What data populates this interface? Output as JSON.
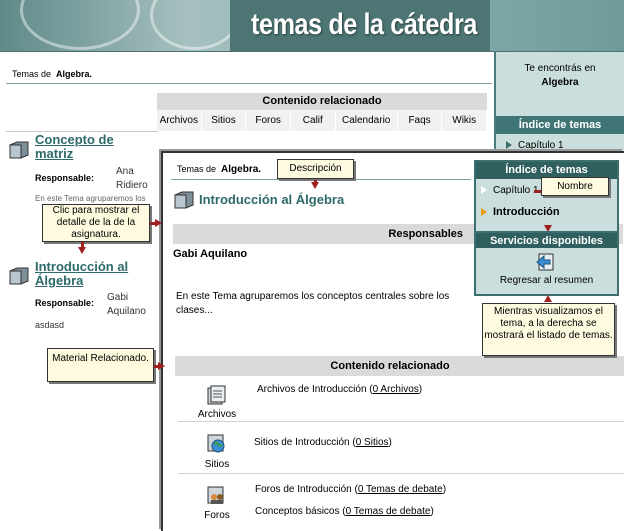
{
  "banner": {
    "title": "temas de la cátedra"
  },
  "background_page": {
    "breadcrumb_prefix": "Temas de",
    "breadcrumb_subject": "Algebra.",
    "related_content": {
      "header": "Contenido relacionado",
      "columns": [
        "Archivos",
        "Sitios",
        "Foros",
        "Calif",
        "Calendario",
        "Faqs",
        "Wikis"
      ]
    },
    "topics": [
      {
        "title_line1": "Concepto de",
        "title_line2": "matriz",
        "responsible_label": "Responsable:",
        "responsible_name_1": "Ana",
        "responsible_name_2": "Ridiero",
        "description": "En este Tema agruparemos los"
      },
      {
        "title_line1": "Introducción al",
        "title_line2": "Álgebra",
        "responsible_label": "Responsable:",
        "responsible_name_1": "Gabi",
        "responsible_name_2": "Aquilano",
        "description": "asdasd"
      }
    ]
  },
  "background_sidebar": {
    "info_line1": "Te encontrás en",
    "info_line2": "Algebra",
    "index_header": "Índice de temas",
    "item": "Capítulo 1"
  },
  "detail_window": {
    "breadcrumb_prefix": "Temas de",
    "breadcrumb_subject": "Algebra.",
    "topic_title": "Introducción al Álgebra",
    "responsibles_header": "Responsables",
    "responsible_name": "Gabi Aquilano",
    "description_line1": "En este Tema agruparemos los conceptos centrales sobre los",
    "description_line2": "clases...",
    "related_header": "Contenido relacionado",
    "related": [
      {
        "icon_label": "Archivos",
        "text": "Archivos de Introducción (",
        "link": "0 Archivos",
        "suffix": ")"
      },
      {
        "icon_label": "Sitios",
        "text": "Sitios de Introducción (",
        "link": "0 Sitios",
        "suffix": ")"
      },
      {
        "icon_label": "Foros",
        "text": "Foros de Introducción (",
        "link": "0 Temas de debate",
        "suffix": ")",
        "text2": "Conceptos básicos (",
        "link2": "0 Temas de debate",
        "suffix2": ")"
      }
    ]
  },
  "detail_panel": {
    "index_header": "Índice de temas",
    "item1": "Capítulo 1",
    "item2": "Introducción",
    "services_header": "Servicios disponibles",
    "back_label": "Regresar al resumen"
  },
  "callouts": {
    "detail": "Clic para mostrar el detalle de la de la asignatura.",
    "description": "Descripción",
    "name": "Nombre",
    "related": "Material Relacionado.",
    "sidebar": "Mientras visualizamos el tema, a la derecha se mostrará el listado de temas."
  },
  "colors": {
    "accent": "#3d6f6e",
    "link": "#2e6a6a",
    "arrow": "#a01f1f",
    "callout_bg": "#fffbe0"
  }
}
